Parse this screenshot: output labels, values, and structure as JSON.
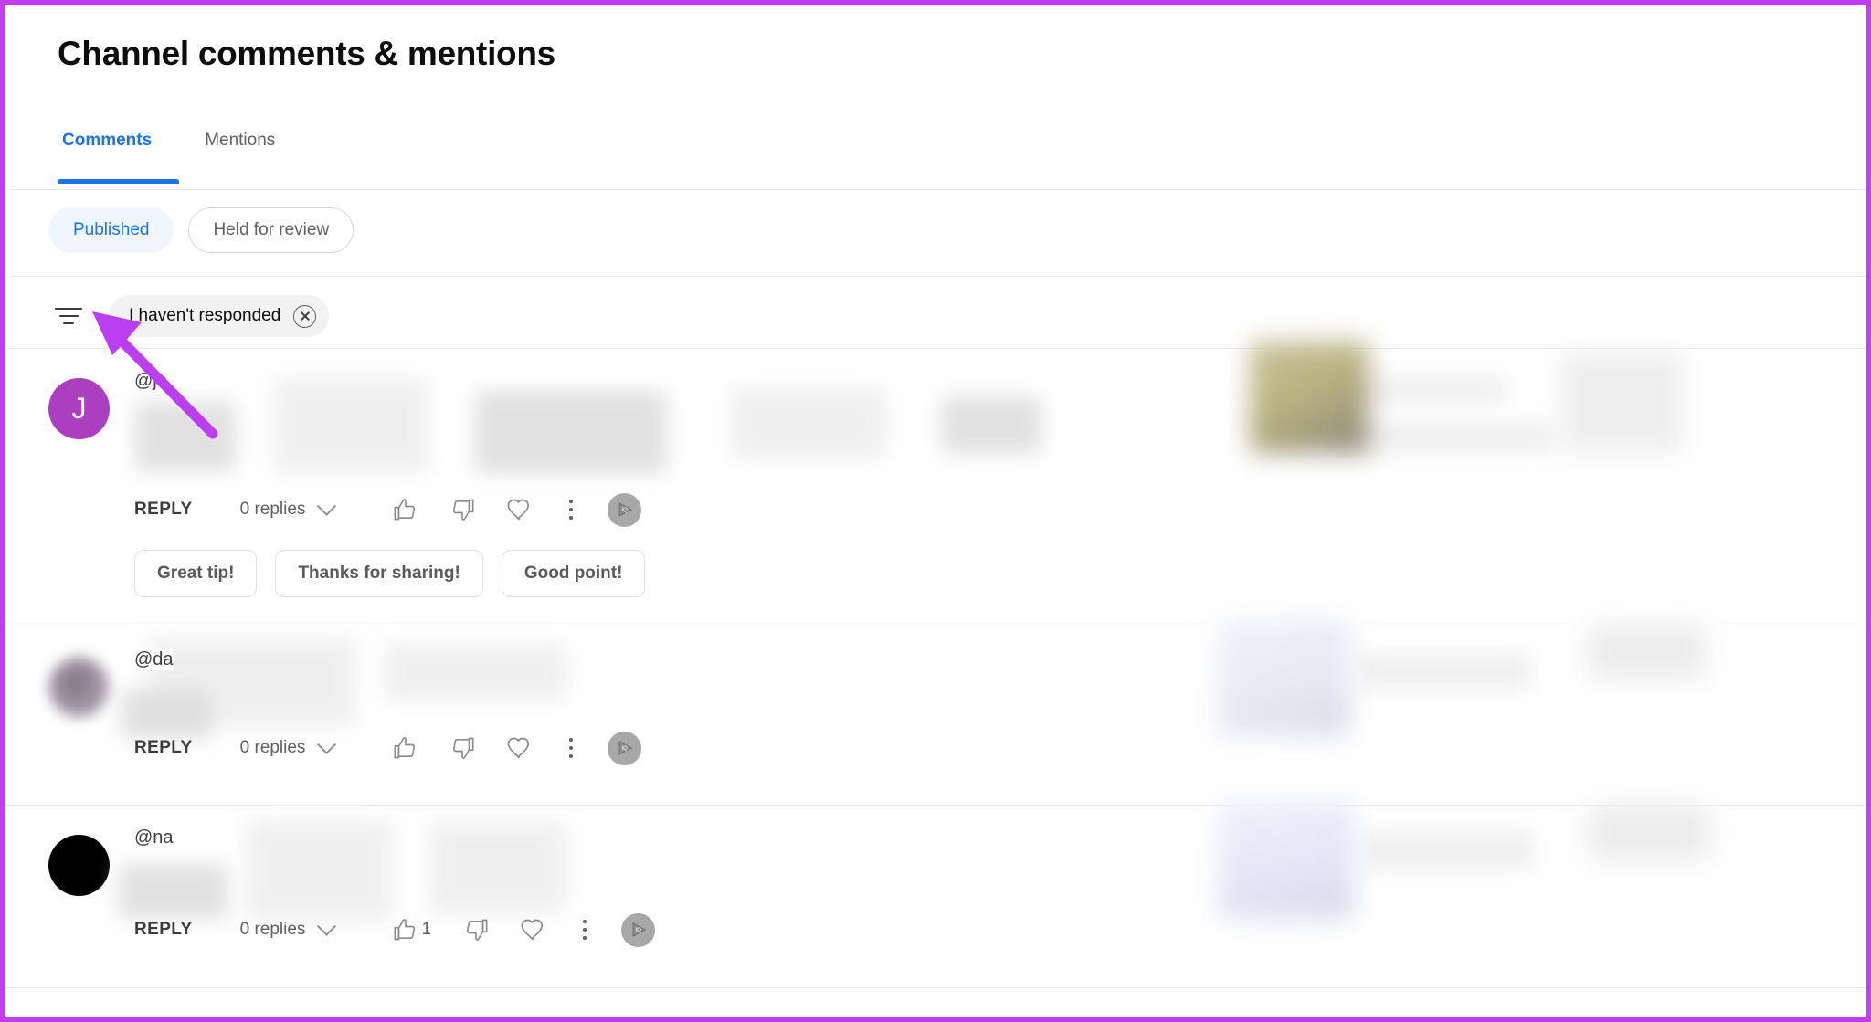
{
  "page": {
    "title": "Channel comments & mentions",
    "accent_blue": "#1a73e8",
    "annotation_purple": "#c13cff",
    "border_color": "#c13cff"
  },
  "tabs": [
    {
      "label": "Comments",
      "active": true
    },
    {
      "label": "Mentions",
      "active": false
    }
  ],
  "status_filters": [
    {
      "label": "Published",
      "selected": true
    },
    {
      "label": "Held for review",
      "selected": false
    }
  ],
  "filter_bar": {
    "filter_icon": "filter-icon",
    "active_chip": {
      "label": "I haven't responded",
      "remove_icon": "close-circle-icon"
    }
  },
  "comments": [
    {
      "author": "@je",
      "avatar_letter": "J",
      "avatar_color": "#ab3fc0",
      "avatar_blurred": false,
      "reply_label": "REPLY",
      "replies_label": "0 replies",
      "like_count": "",
      "thumbs_up_icon": "thumbs-up-icon",
      "thumbs_down_icon": "thumbs-down-icon",
      "heart_icon": "heart-icon",
      "more_icon": "kebab-menu-icon",
      "channel_avatar_icon": "channel-avatar-icon",
      "quick_replies": [
        "Great tip!",
        "Thanks for sharing!",
        "Good point!"
      ]
    },
    {
      "author": "@da",
      "avatar_letter": "",
      "avatar_color": "#8d8095",
      "avatar_blurred": true,
      "reply_label": "REPLY",
      "replies_label": "0 replies",
      "like_count": "",
      "thumbs_up_icon": "thumbs-up-icon",
      "thumbs_down_icon": "thumbs-down-icon",
      "heart_icon": "heart-icon",
      "more_icon": "kebab-menu-icon",
      "channel_avatar_icon": "channel-avatar-icon",
      "quick_replies": []
    },
    {
      "author": "@na",
      "avatar_letter": "",
      "avatar_color": "#000000",
      "avatar_blurred": false,
      "reply_label": "REPLY",
      "replies_label": "0 replies",
      "like_count": "1",
      "thumbs_up_icon": "thumbs-up-icon",
      "thumbs_down_icon": "thumbs-down-icon",
      "heart_icon": "heart-icon",
      "more_icon": "kebab-menu-icon",
      "channel_avatar_icon": "channel-avatar-icon",
      "quick_replies": []
    }
  ],
  "annotation": {
    "type": "arrow",
    "color": "#c13cff",
    "points_to": "filter-icon"
  }
}
